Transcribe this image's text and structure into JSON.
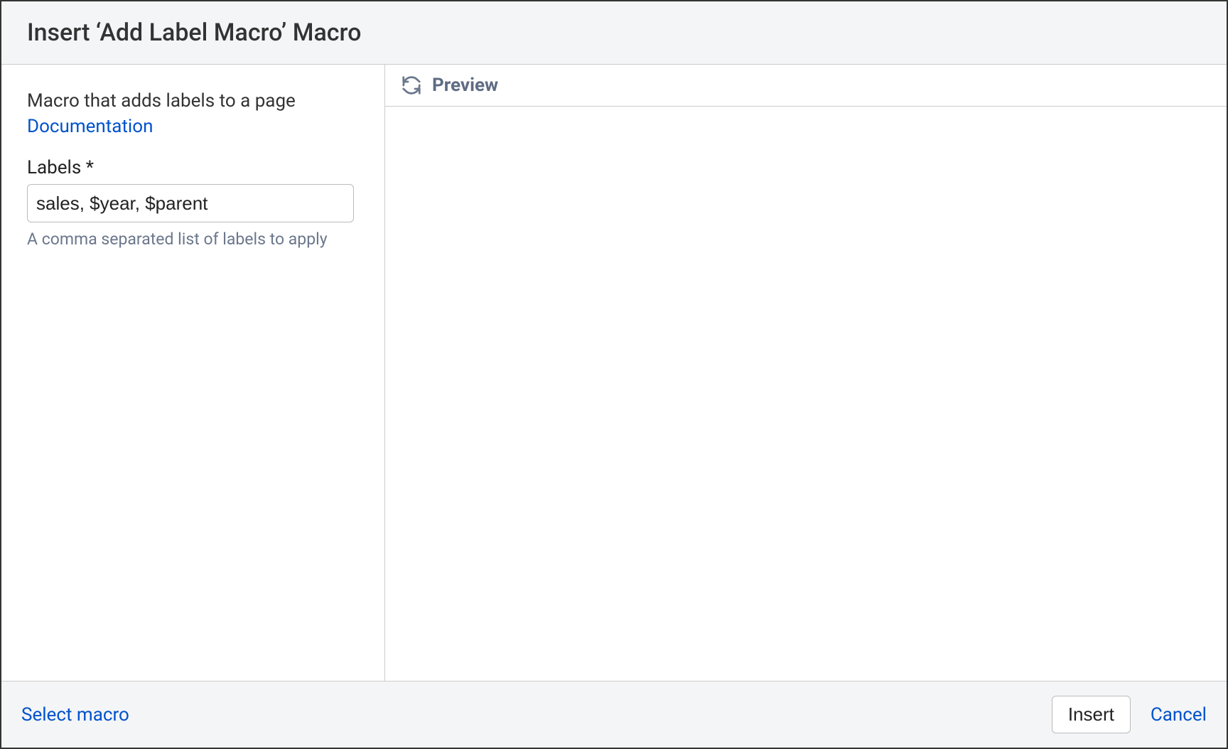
{
  "header": {
    "title": "Insert ‘Add Label Macro’ Macro"
  },
  "left": {
    "description": "Macro that adds labels to a page",
    "doc_link": "Documentation",
    "labels_field": {
      "label": "Labels *",
      "value": "sales, $year, $parent",
      "help": "A comma separated list of labels to apply"
    }
  },
  "right": {
    "preview_label": "Preview"
  },
  "footer": {
    "select_macro": "Select macro",
    "insert": "Insert",
    "cancel": "Cancel"
  }
}
